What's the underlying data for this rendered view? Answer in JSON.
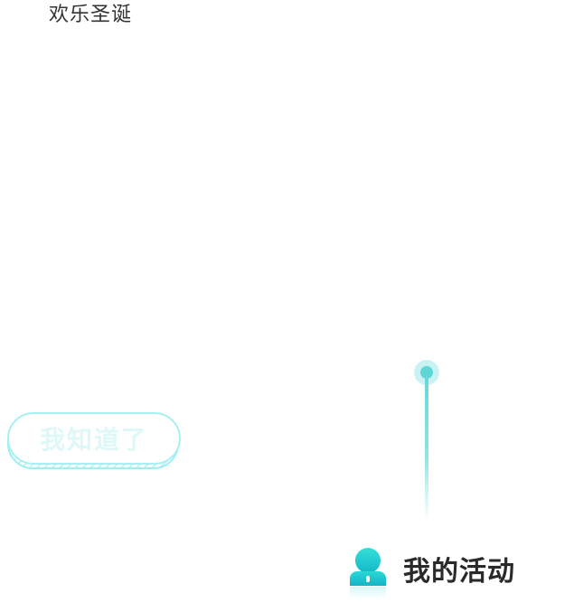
{
  "header": {
    "label": "欢乐圣诞"
  },
  "dialog": {
    "got_it_label": "我知道了"
  },
  "nav": {
    "my_activity_label": "我的活动",
    "my_activity_icon": "user-icon"
  },
  "colors": {
    "accent": "#5fd6d6",
    "accent_light": "#c9f3f3",
    "button_border": "#a7f0f2",
    "button_text": "#def8f8",
    "text_dark": "#2a2a2a"
  }
}
